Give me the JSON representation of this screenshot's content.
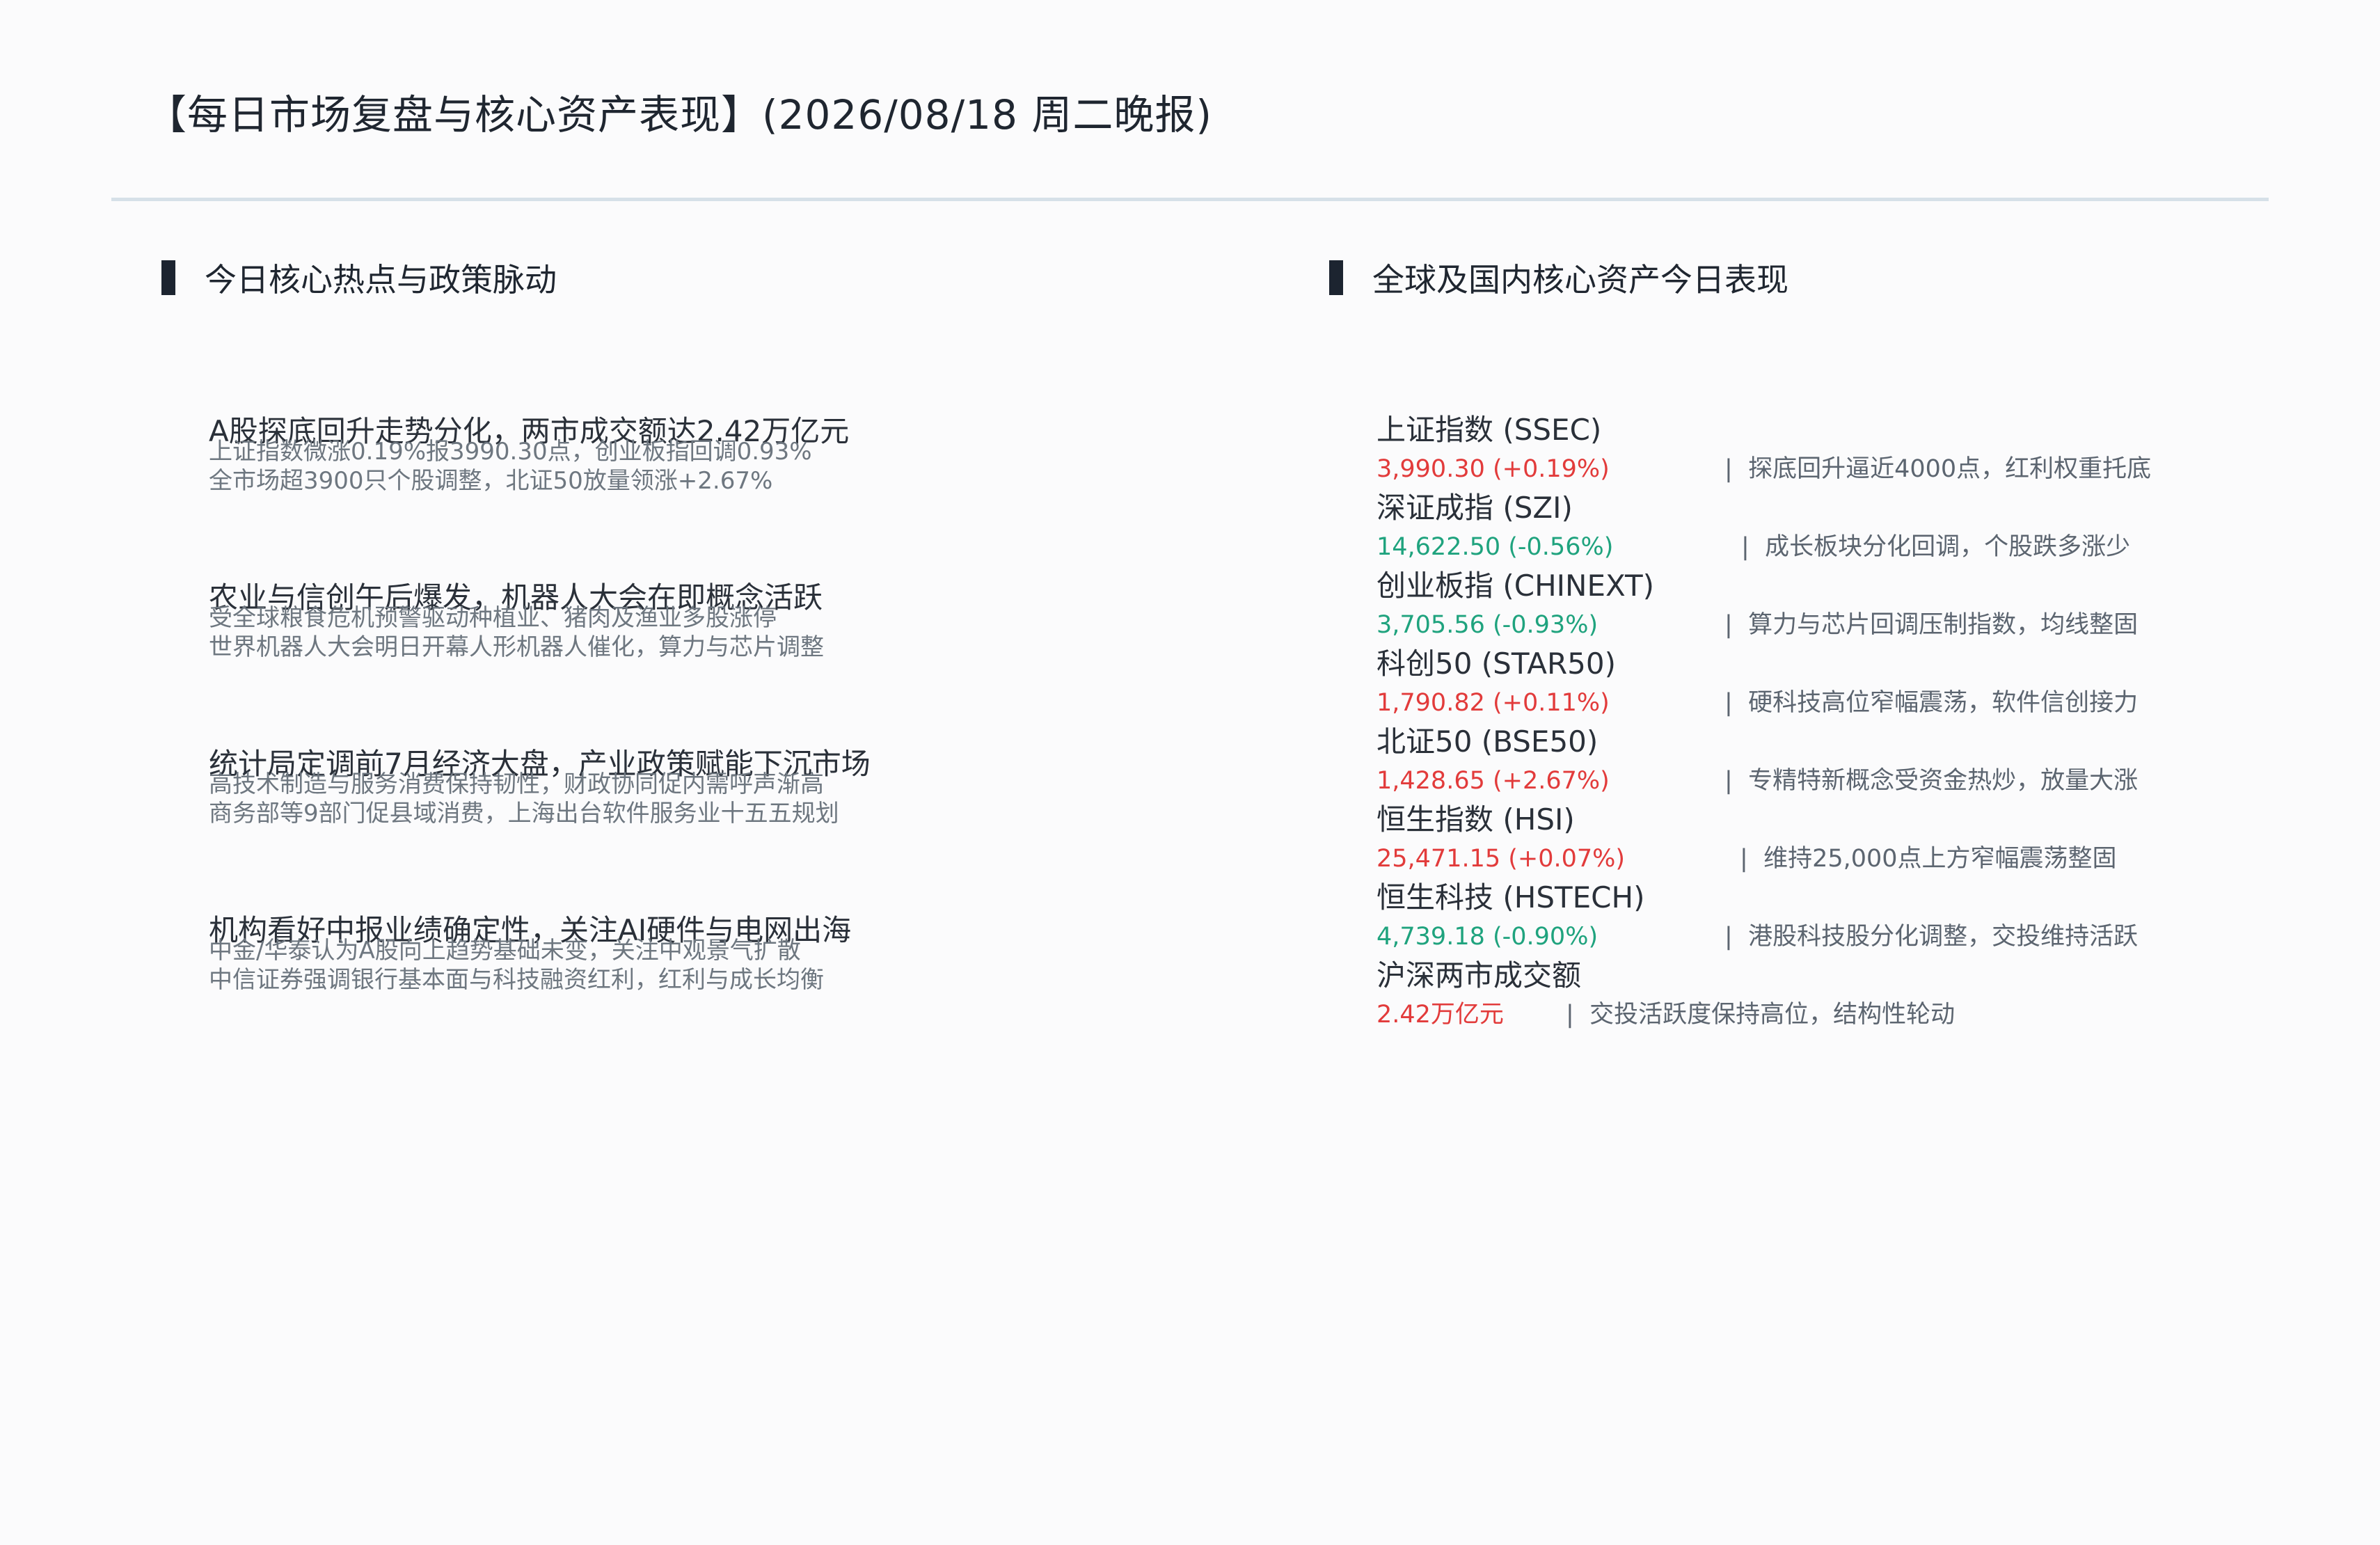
{
  "title": "【每日市场复盘与核心资产表现】(2026/08/18 周二晚报)",
  "left_section": {
    "heading": "今日核心热点与政策脉动",
    "items": [
      {
        "headline": "A股探底回升走势分化，两市成交额达2.42万亿元",
        "line1": "上证指数微涨0.19%报3990.30点，创业板指回调0.93%",
        "line2": "全市场超3900只个股调整，北证50放量领涨+2.67%"
      },
      {
        "headline": "农业与信创午后爆发，机器人大会在即概念活跃",
        "line1": "受全球粮食危机预警驱动种植业、猪肉及渔业多股涨停",
        "line2": "世界机器人大会明日开幕人形机器人催化，算力与芯片调整"
      },
      {
        "headline": "统计局定调前7月经济大盘，产业政策赋能下沉市场",
        "line1": "高技术制造与服务消费保持韧性，财政协同促内需呼声渐高",
        "line2": "商务部等9部门促县域消费，上海出台软件服务业十五五规划"
      },
      {
        "headline": "机构看好中报业绩确定性，关注AI硬件与电网出海",
        "line1": "中金/华泰认为A股向上趋势基础未变，关注中观景气扩散",
        "line2": "中信证券强调银行基本面与科技融资红利，红利与成长均衡"
      }
    ]
  },
  "right_section": {
    "heading": "全球及国内核心资产今日表现",
    "separator": "|",
    "assets": [
      {
        "name": "上证指数 (SSEC)",
        "value": "3,990.30 (+0.19%)",
        "direction": "up",
        "note": "探底回升逼近4000点，红利权重托底"
      },
      {
        "name": "深证成指 (SZI)",
        "value": "14,622.50 (-0.56%)",
        "direction": "down",
        "note": "成长板块分化回调，个股跌多涨少"
      },
      {
        "name": "创业板指 (CHINEXT)",
        "value": "3,705.56 (-0.93%)",
        "direction": "down",
        "note": "算力与芯片回调压制指数，均线整固"
      },
      {
        "name": "科创50 (STAR50)",
        "value": "1,790.82 (+0.11%)",
        "direction": "up",
        "note": "硬科技高位窄幅震荡，软件信创接力"
      },
      {
        "name": "北证50 (BSE50)",
        "value": "1,428.65 (+2.67%)",
        "direction": "up",
        "note": "专精特新概念受资金热炒，放量大涨"
      },
      {
        "name": "恒生指数 (HSI)",
        "value": "25,471.15 (+0.07%)",
        "direction": "up",
        "note": "维持25,000点上方窄幅震荡整固"
      },
      {
        "name": "恒生科技 (HSTECH)",
        "value": "4,739.18 (-0.90%)",
        "direction": "down",
        "note": "港股科技股分化调整，交投维持活跃"
      },
      {
        "name": "沪深两市成交额",
        "value": "2.42万亿元",
        "direction": "up",
        "note": "交投活跃度保持高位，结构性轮动"
      }
    ]
  },
  "colors": {
    "up": "#e23b3b",
    "down": "#1fa37e",
    "divider": "#d6e0e8",
    "marker": "#1c2430"
  }
}
